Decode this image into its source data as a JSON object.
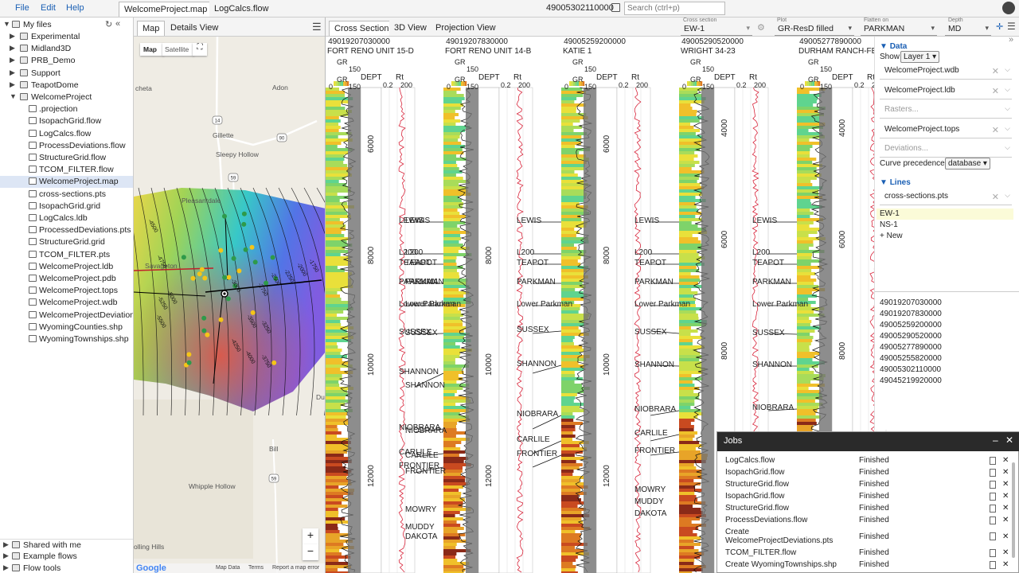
{
  "menu": [
    "File",
    "Edit",
    "Help"
  ],
  "tabs": [
    "WelcomeProject.map x",
    "LogCalcs.flow"
  ],
  "header": {
    "well_id": "49005302110000",
    "search_placeholder": "Search (ctrl+p)"
  },
  "sidebar": {
    "my_files": "My files",
    "items": [
      {
        "label": "Experimental",
        "folder": true
      },
      {
        "label": "Midland3D",
        "folder": true
      },
      {
        "label": "PRB_Demo",
        "folder": true
      },
      {
        "label": "Support",
        "folder": true
      },
      {
        "label": "TeapotDome",
        "folder": true
      },
      {
        "label": "WelcomeProject",
        "folder": true,
        "open": true
      },
      {
        "label": ".projection"
      },
      {
        "label": "IsopachGrid.flow"
      },
      {
        "label": "LogCalcs.flow"
      },
      {
        "label": "ProcessDeviations.flow"
      },
      {
        "label": "StructureGrid.flow"
      },
      {
        "label": "TCOM_FILTER.flow"
      },
      {
        "label": "WelcomeProject.map",
        "selected": true
      },
      {
        "label": "cross-sections.pts"
      },
      {
        "label": "IsopachGrid.grid"
      },
      {
        "label": "LogCalcs.ldb"
      },
      {
        "label": "ProcessedDeviations.pts"
      },
      {
        "label": "StructureGrid.grid"
      },
      {
        "label": "TCOM_FILTER.pts"
      },
      {
        "label": "WelcomeProject.ldb"
      },
      {
        "label": "WelcomeProject.pdb"
      },
      {
        "label": "WelcomeProject.tops"
      },
      {
        "label": "WelcomeProject.wdb"
      },
      {
        "label": "WelcomeProjectDeviations"
      },
      {
        "label": "WyomingCounties.shp"
      },
      {
        "label": "WyomingTownships.shp"
      }
    ],
    "bottom": [
      "Shared with me",
      "Example flows",
      "Flow tools"
    ]
  },
  "map": {
    "tabs": [
      "Map",
      "Details View"
    ],
    "types": [
      "Map",
      "Satellite"
    ],
    "places": [
      "Adon",
      "Gillette",
      "Sleepy Hollow",
      "Pleasantdale",
      "Savageton",
      "Bill",
      "Whipple Hollow",
      "olling Hills",
      "Du",
      "cheta"
    ],
    "road_shields": [
      "14",
      "90",
      "59",
      "59"
    ],
    "contours": [
      "-4500",
      "-4750",
      "-3000",
      "-2750",
      "-2500",
      "-2250",
      "-2000",
      "-1750",
      "-5250",
      "-5000",
      "-5500",
      "-3500",
      "-3250",
      "-3750",
      "-4000",
      "-4250"
    ],
    "footer": [
      "Map Data",
      "Terms",
      "Report a map error"
    ],
    "logo": "Google",
    "zoom_in": "+",
    "zoom_out": "−"
  },
  "xsection": {
    "tabs": [
      "Cross Section",
      "3D View",
      "Projection View"
    ],
    "controls": [
      {
        "label": "Cross section",
        "value": "EW-1"
      },
      {
        "label": "Plot",
        "value": "GR-ResD filled"
      },
      {
        "label": "Flatten on",
        "value": "PARKMAN"
      },
      {
        "label": "Depth",
        "value": "MD"
      }
    ],
    "wells": [
      {
        "id": "49019207030000",
        "name": "FORT RENO UNIT 15-D"
      },
      {
        "id": "49019207830000",
        "name": "FORT RENO UNIT 14-B"
      },
      {
        "id": "49005259200000",
        "name": "KATIE 1"
      },
      {
        "id": "49005290520000",
        "name": "WRIGHT 34-23"
      },
      {
        "id": "49005277890000",
        "name": "DURHAM RANCH-FEDER"
      }
    ],
    "track_headers": {
      "gr": "GR",
      "gr_range": [
        "0",
        "150"
      ],
      "depth": "DEPT",
      "rt": "Rt",
      "rt_range": [
        "0.2",
        "200"
      ]
    },
    "depth_labels": [
      [
        "6000",
        "8000",
        "10000",
        "12000"
      ],
      [
        "8000",
        "10000",
        "12000"
      ],
      [
        "6000",
        "8000",
        "10000",
        "12000"
      ],
      [
        "4000",
        "6000",
        "8000",
        "10000"
      ],
      [
        "4000",
        "6000",
        "8000"
      ]
    ],
    "formations": [
      "LEWIS",
      "L200",
      "TEAPOT",
      "PARKMAN",
      "Lower Parkman",
      "SUSSEX",
      "SHANNON",
      "NIOBRARA",
      "CARLILE",
      "FRONTIER",
      "MOWRY",
      "MUDDY",
      "DAKOTA"
    ]
  },
  "data_panel": {
    "data_heading": "Data",
    "show_label": "Show",
    "show_value": "Layer 1",
    "rows": [
      "WelcomeProject.wdb",
      "WelcomeProject.ldb",
      "Rasters...",
      "WelcomeProject.tops",
      "Deviations..."
    ],
    "curve_label": "Curve precedence:",
    "curve_value": "database",
    "lines_heading": "Lines",
    "lines_file": "cross-sections.pts",
    "lines": [
      "EW-1",
      "NS-1"
    ],
    "new_label": "New",
    "well_list": [
      "49019207030000",
      "49019207830000",
      "49005259200000",
      "49005290520000",
      "49005277890000",
      "49005255820000",
      "49005302110000",
      "49045219920000"
    ]
  },
  "jobs": {
    "title": "Jobs",
    "items": [
      {
        "name": "LogCalcs.flow",
        "status": "Finished"
      },
      {
        "name": "IsopachGrid.flow",
        "status": "Finished"
      },
      {
        "name": "StructureGrid.flow",
        "status": "Finished"
      },
      {
        "name": "IsopachGrid.flow",
        "status": "Finished"
      },
      {
        "name": "StructureGrid.flow",
        "status": "Finished"
      },
      {
        "name": "ProcessDeviations.flow",
        "status": "Finished"
      },
      {
        "name": "Create WelcomeProjectDeviations.pts",
        "status": "Finished"
      },
      {
        "name": "TCOM_FILTER.flow",
        "status": "Finished"
      },
      {
        "name": "Create WyomingTownships.shp",
        "status": "Finished"
      }
    ]
  }
}
